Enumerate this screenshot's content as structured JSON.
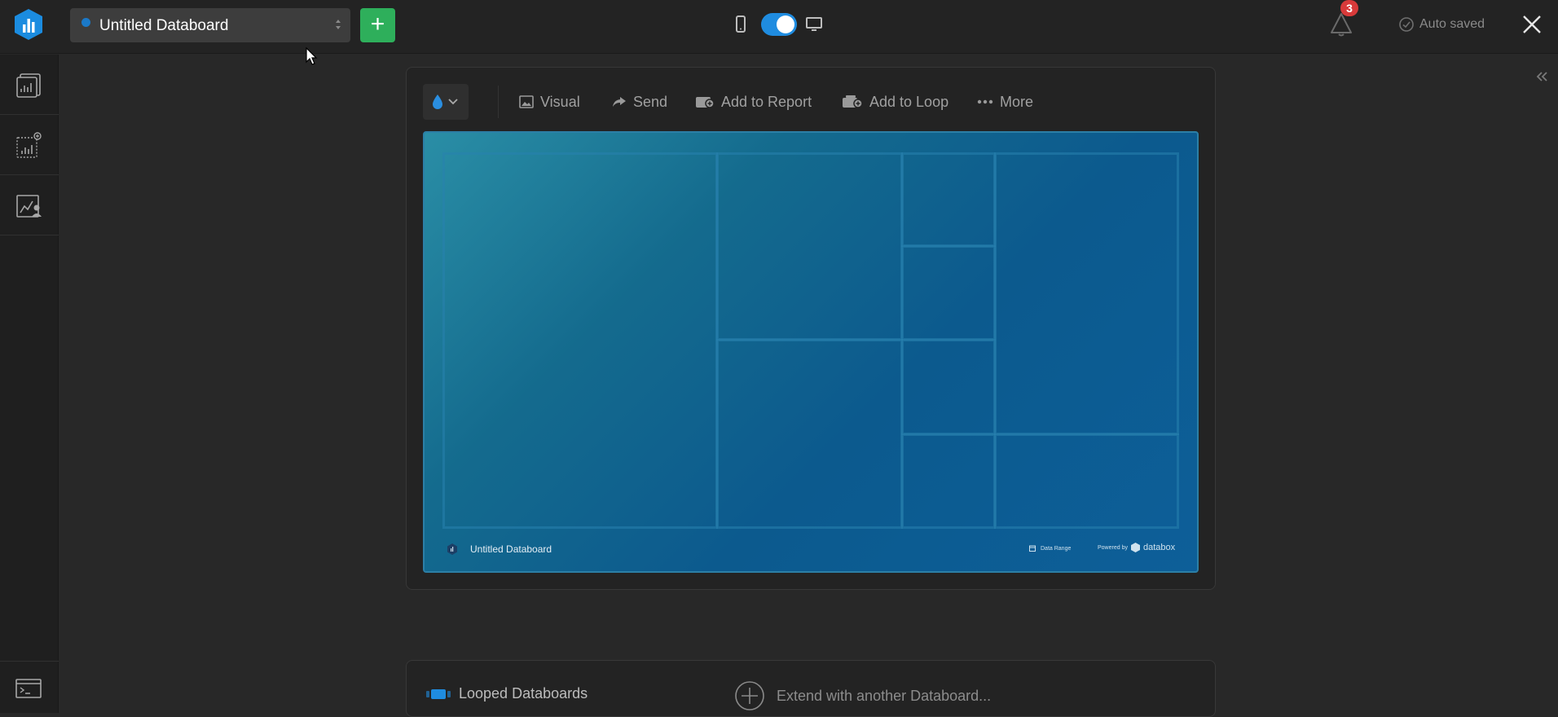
{
  "topbar": {
    "databoard_name": "Untitled Databoard",
    "add_label": "+",
    "notifications_count": "3",
    "autosave_label": "Auto saved",
    "view_mode": "desktop"
  },
  "sidebar": {
    "items": [
      {
        "icon": "databoards-icon"
      },
      {
        "icon": "new-metric-icon"
      },
      {
        "icon": "user-metrics-icon"
      }
    ],
    "bottom_icon": "terminal-icon"
  },
  "toolbar": {
    "visual_label": "Visual",
    "send_label": "Send",
    "add_report_label": "Add to Report",
    "add_loop_label": "Add to Loop",
    "more_label": "More"
  },
  "preview": {
    "title": "Untitled Databoard",
    "date_range_label": "Data Range",
    "powered_label": "Powered by",
    "brand": "databox"
  },
  "loop": {
    "label": "Looped Databoards",
    "extend_label": "Extend with another Databoard..."
  },
  "colors": {
    "accent_blue": "#1f8ce0",
    "add_green": "#2eaf5b",
    "badge_red": "#d83a3a",
    "background": "#282828"
  }
}
